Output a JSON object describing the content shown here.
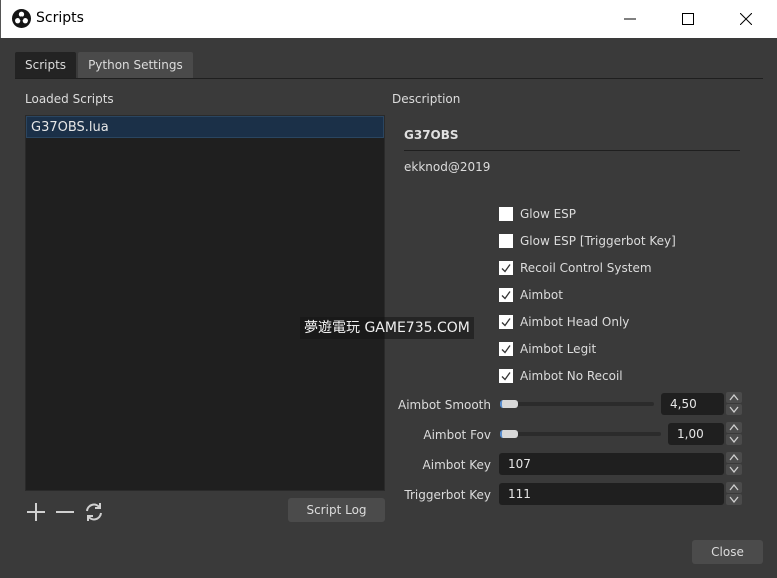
{
  "window": {
    "title": "Scripts",
    "logo_icon": "obs-logo-icon",
    "controls": [
      "minimize-icon",
      "maximize-icon",
      "close-icon"
    ]
  },
  "tabs": [
    {
      "label": "Scripts",
      "active": true
    },
    {
      "label": "Python Settings",
      "active": false
    }
  ],
  "left": {
    "loaded_scripts_label": "Loaded Scripts",
    "scripts": [
      {
        "name": "G37OBS.lua",
        "selected": true
      }
    ],
    "add_icon": "plus-icon",
    "remove_icon": "minus-icon",
    "reload_icon": "refresh-icon",
    "script_log_label": "Script Log"
  },
  "right": {
    "description_label": "Description",
    "script_title": "G37OBS",
    "script_author": "ekknod@2019",
    "checkboxes": [
      {
        "label": "Glow ESP",
        "checked": false
      },
      {
        "label": "Glow ESP [Triggerbot Key]",
        "checked": false
      },
      {
        "label": "Recoil Control System",
        "checked": true
      },
      {
        "label": "Aimbot",
        "checked": true
      },
      {
        "label": "Aimbot Head Only",
        "checked": true
      },
      {
        "label": "Aimbot Legit",
        "checked": true
      },
      {
        "label": "Aimbot No Recoil",
        "checked": true
      }
    ],
    "sliders": [
      {
        "label": "Aimbot Smooth",
        "value": "4,50",
        "fraction": 0.0
      },
      {
        "label": "Aimbot Fov",
        "value": "1,00",
        "fraction": 0.0
      }
    ],
    "number_fields": [
      {
        "label": "Aimbot Key",
        "value": "107"
      },
      {
        "label": "Triggerbot Key",
        "value": "111"
      }
    ]
  },
  "footer": {
    "close_label": "Close"
  },
  "watermark": "夢遊電玩 GAME735.COM"
}
